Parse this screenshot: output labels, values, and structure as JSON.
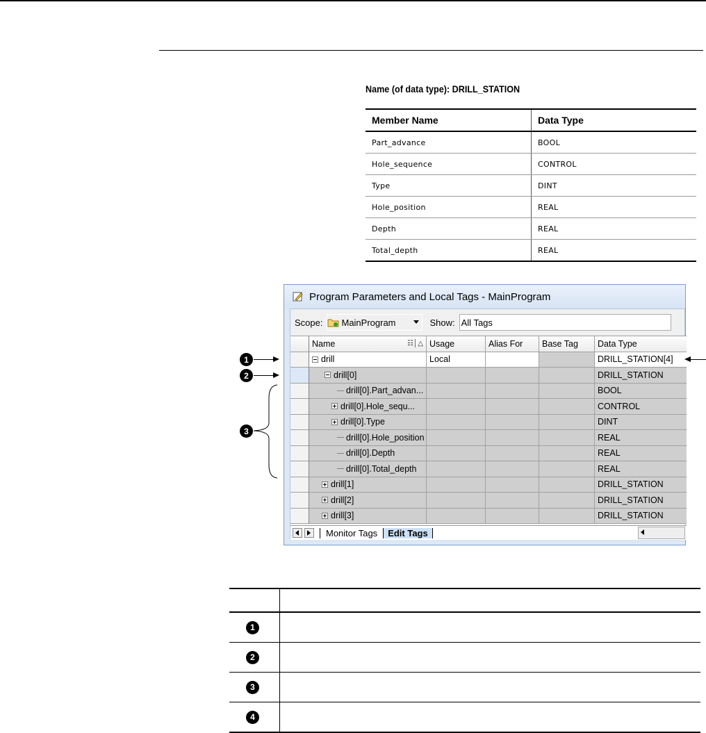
{
  "datatype_table": {
    "caption": "Name (of data type): DRILL_STATION",
    "headers": [
      "Member Name",
      "Data Type"
    ],
    "rows": [
      [
        "Part_advance",
        "BOOL"
      ],
      [
        "Hole_sequence",
        "CONTROL"
      ],
      [
        "Type",
        "DINT"
      ],
      [
        "Hole_position",
        "REAL"
      ],
      [
        "Depth",
        "REAL"
      ],
      [
        "Total_depth",
        "REAL"
      ]
    ]
  },
  "window": {
    "title": "Program Parameters and Local Tags - MainProgram",
    "scope_label": "Scope:",
    "scope_value": "MainProgram",
    "show_label": "Show:",
    "show_value": "All Tags",
    "columns": [
      "Name",
      "Usage",
      "Alias For",
      "Base Tag",
      "Data Type"
    ],
    "rows": [
      {
        "name": "drill",
        "usage": "Local",
        "type": "DRILL_STATION[4]"
      },
      {
        "name": "drill[0]",
        "usage": "",
        "type": "DRILL_STATION"
      },
      {
        "name": "drill[0].Part_advan...",
        "usage": "",
        "type": "BOOL"
      },
      {
        "name": "drill[0].Hole_sequ...",
        "usage": "",
        "type": "CONTROL"
      },
      {
        "name": "drill[0].Type",
        "usage": "",
        "type": "DINT"
      },
      {
        "name": "drill[0].Hole_position",
        "usage": "",
        "type": "REAL"
      },
      {
        "name": "drill[0].Depth",
        "usage": "",
        "type": "REAL"
      },
      {
        "name": "drill[0].Total_depth",
        "usage": "",
        "type": "REAL"
      },
      {
        "name": "drill[1]",
        "usage": "",
        "type": "DRILL_STATION"
      },
      {
        "name": "drill[2]",
        "usage": "",
        "type": "DRILL_STATION"
      },
      {
        "name": "drill[3]",
        "usage": "",
        "type": "DRILL_STATION"
      }
    ],
    "tabs": [
      "Monitor Tags",
      "Edit Tags"
    ]
  },
  "callouts": [
    "1",
    "2",
    "3",
    "4"
  ]
}
